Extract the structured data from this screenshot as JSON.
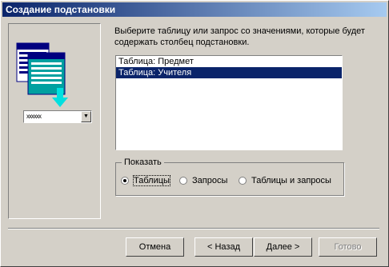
{
  "window": {
    "title": "Создание подстановки"
  },
  "illustration": {
    "combo_text": "xxxxxx"
  },
  "instruction": "Выберите таблицу или запрос со значениями, которые будет содержать столбец подстановки.",
  "list": {
    "items": [
      "Таблица: Предмет",
      "Таблица: Учителя"
    ],
    "selected_index": 1
  },
  "show_group": {
    "label": "Показать",
    "options": [
      {
        "label": "Таблицы",
        "checked": true
      },
      {
        "label": "Запросы",
        "checked": false
      },
      {
        "label": "Таблицы и запросы",
        "checked": false
      }
    ]
  },
  "buttons": {
    "cancel": "Отмена",
    "back": "< Назад",
    "next": "Далее >",
    "finish": "Готово"
  },
  "colors": {
    "title_start": "#0a246a",
    "title_end": "#a6caf0",
    "selection": "#0a246a",
    "face": "#d4d0c8"
  }
}
